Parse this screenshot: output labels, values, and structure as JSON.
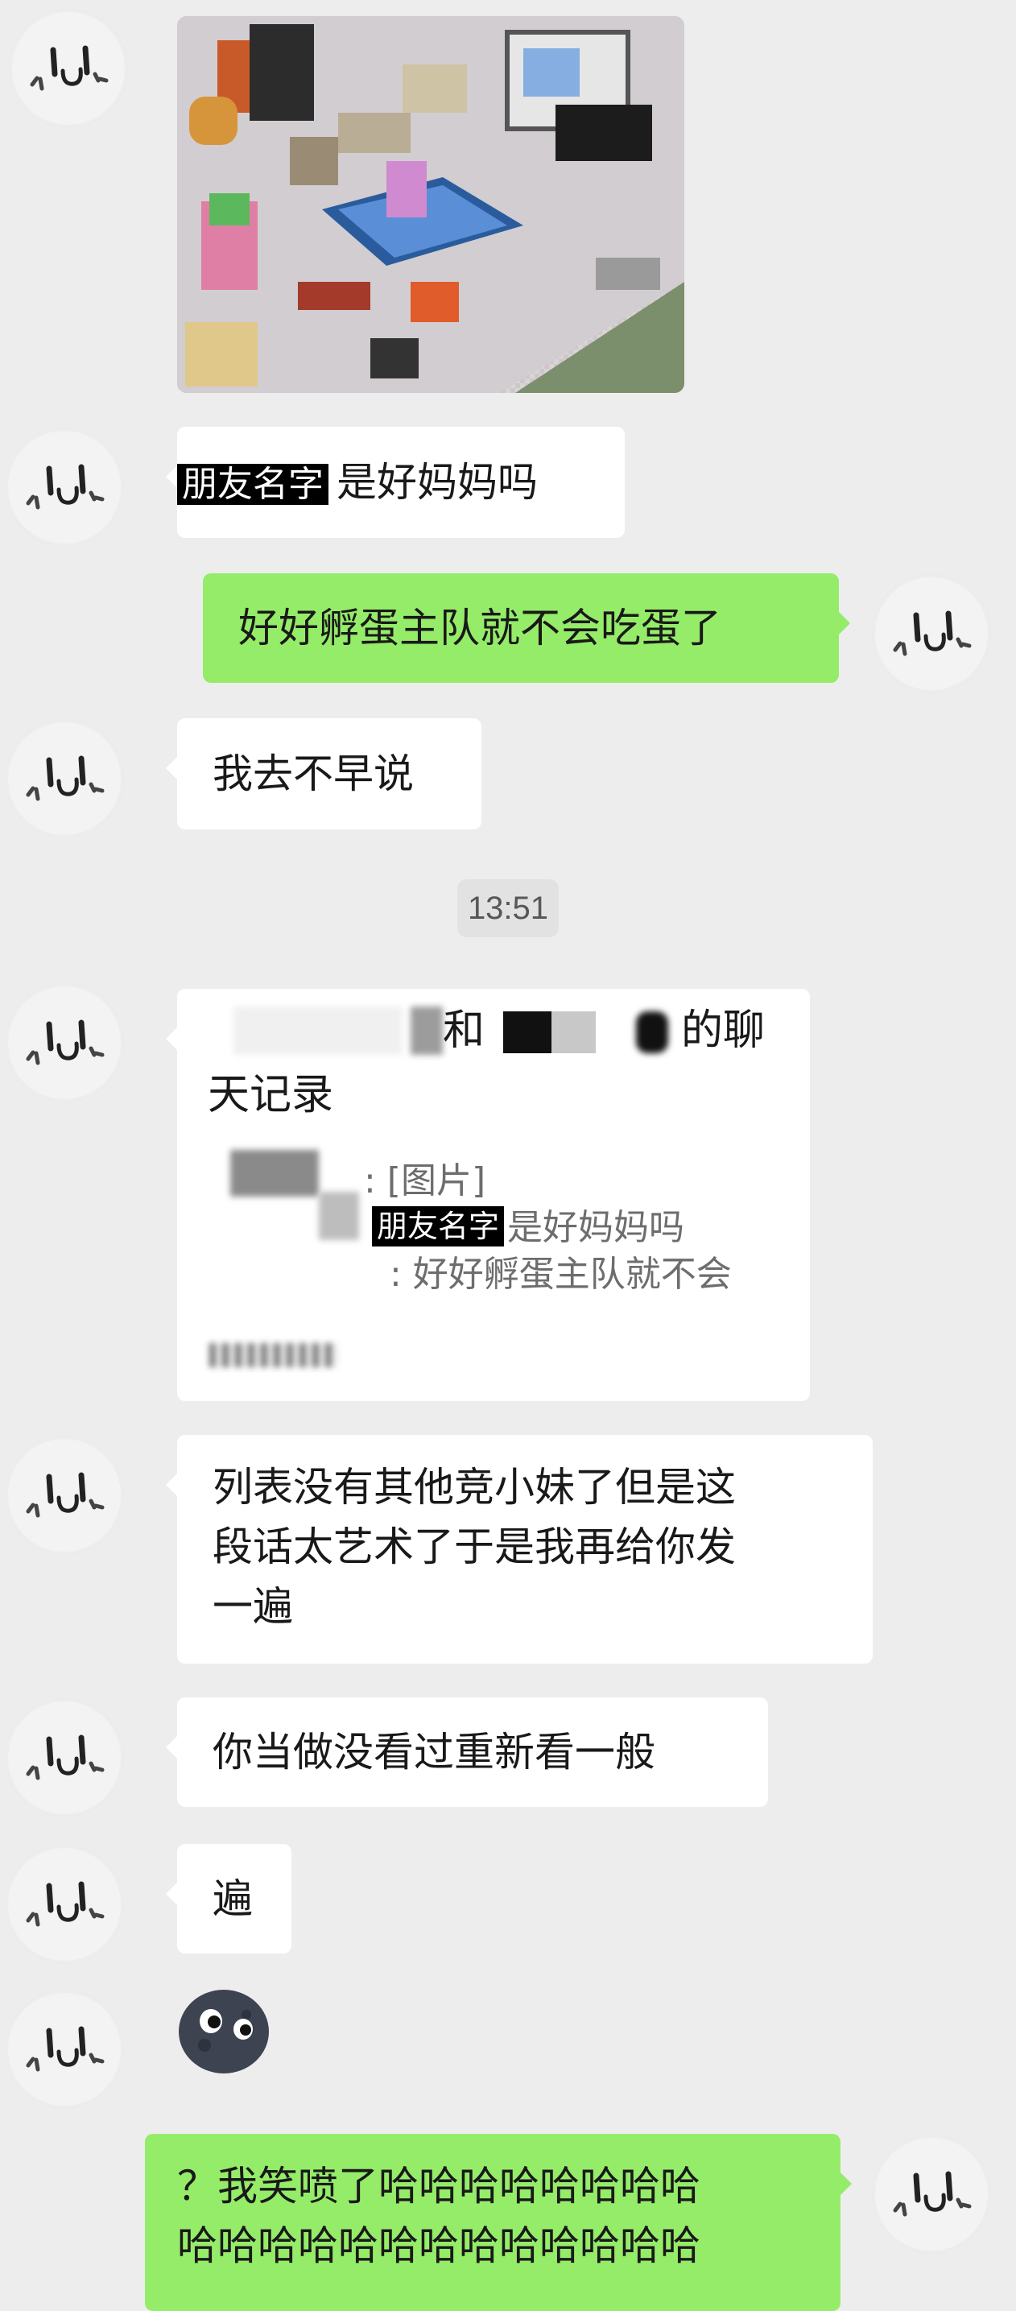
{
  "messages": [
    {
      "type": "image",
      "from": "friend",
      "alt": "pixel room screenshot"
    },
    {
      "type": "text",
      "from": "friend",
      "redacted_label": "朋友名字",
      "text": "是好妈妈吗"
    },
    {
      "type": "text",
      "from": "me",
      "text": "好好孵蛋主队就不会吃蛋了"
    },
    {
      "type": "text",
      "from": "friend",
      "text": "我去不早说"
    },
    {
      "type": "timestamp",
      "text": "13:51"
    },
    {
      "type": "chat_record",
      "from": "friend",
      "title_connector": "和",
      "title_suffix": "的聊",
      "title_line2": "天记录",
      "lines": [
        ": [图片]",
        "朋友名字",
        "是好妈妈吗",
        ": 好好孵蛋主队就不会"
      ]
    },
    {
      "type": "text",
      "from": "friend",
      "lines": [
        "列表没有其他竞小妹了但是这",
        "段话太艺术了于是我再给你发",
        "一遍"
      ]
    },
    {
      "type": "text",
      "from": "friend",
      "text": "你当做没看过重新看一般"
    },
    {
      "type": "text",
      "from": "friend",
      "text": "遍"
    },
    {
      "type": "sticker",
      "from": "friend",
      "icon": "dark-moon-face-emoji"
    },
    {
      "type": "text",
      "from": "me",
      "lines": [
        "？我笑喷了哈哈哈哈哈哈哈哈",
        "哈哈哈哈哈哈哈哈哈哈哈哈哈"
      ]
    }
  ],
  "colors": {
    "background": "#ededed",
    "incoming": "#ffffff",
    "outgoing": "#95ec69"
  }
}
